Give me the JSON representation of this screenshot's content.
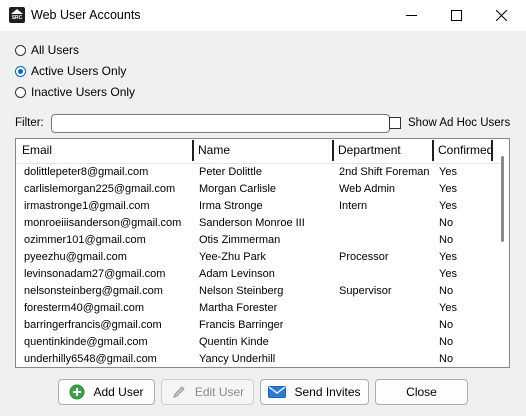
{
  "window": {
    "title": "Web User Accounts",
    "icon_text": "SRC"
  },
  "filters": {
    "all_users": "All Users",
    "active_only": "Active Users Only",
    "inactive_only": "Inactive Users Only",
    "selected": "active_only"
  },
  "filter": {
    "label": "Filter:",
    "value": "",
    "placeholder": ""
  },
  "show_adhoc": {
    "label": "Show Ad Hoc Users",
    "checked": false
  },
  "grid": {
    "columns": [
      "Email",
      "Name",
      "Department",
      "Confirmed"
    ],
    "rows": [
      [
        "dolittlepeter8@gmail.com",
        "Peter Dolittle",
        "2nd Shift Foreman",
        "Yes"
      ],
      [
        "carlislemorgan225@gmail.com",
        "Morgan Carlisle",
        "Web Admin",
        "Yes"
      ],
      [
        "irmastronge1@gmail.com",
        "Irma Stronge",
        "Intern",
        "Yes"
      ],
      [
        "monroeiiisanderson@gmail.com",
        "Sanderson Monroe III",
        "",
        "No"
      ],
      [
        "ozimmer101@gmail.com",
        "Otis Zimmerman",
        "",
        "No"
      ],
      [
        "pyeezhu@gmail.com",
        "Yee-Zhu Park",
        "Processor",
        "Yes"
      ],
      [
        "levinsonadam27@gmail.com",
        "Adam Levinson",
        "",
        "Yes"
      ],
      [
        "nelsonsteinberg@gmail.com",
        "Nelson Steinberg",
        "Supervisor",
        "No"
      ],
      [
        "foresterm40@gmail.com",
        "Martha Forester",
        "",
        "Yes"
      ],
      [
        "barringerfrancis@gmail.com",
        "Francis Barringer",
        "",
        "No"
      ],
      [
        "quentinkinde@gmail.com",
        "Quentin Kinde",
        "",
        "No"
      ],
      [
        "underhilly6548@gmail.com",
        "Yancy Underhill",
        "",
        "No"
      ]
    ]
  },
  "buttons": {
    "add_user": "Add User",
    "edit_user": "Edit User",
    "send_invites": "Send Invites",
    "close": "Close"
  },
  "colors": {
    "accent": "#0067c0",
    "add_icon": "#3aa04a",
    "mail_icon": "#2b7cd3"
  }
}
